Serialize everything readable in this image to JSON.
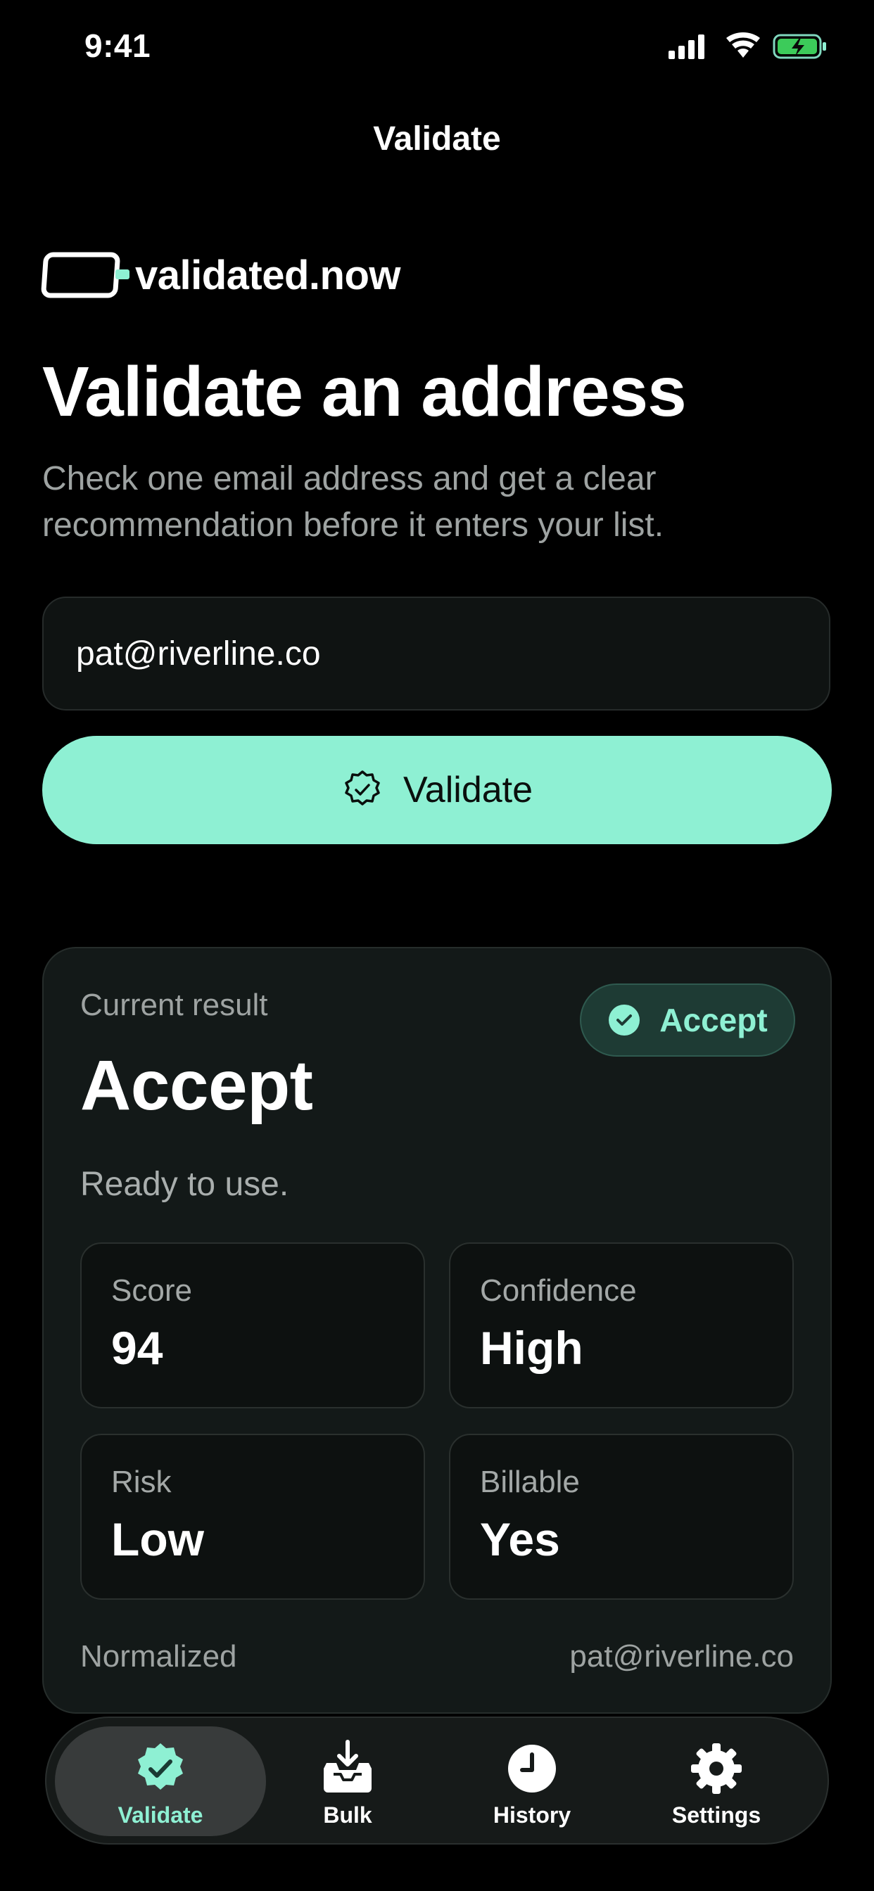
{
  "status_bar": {
    "time": "9:41"
  },
  "nav": {
    "title": "Validate"
  },
  "brand": {
    "name": "validated.now"
  },
  "header": {
    "title": "Validate an address",
    "subtitle": "Check one email address and get a clear recommendation before it enters your list."
  },
  "form": {
    "email_value": "pat@riverline.co",
    "validate_label": "Validate"
  },
  "result": {
    "kicker": "Current result",
    "title": "Accept",
    "badge_label": "Accept",
    "description": "Ready to use.",
    "metrics": [
      {
        "label": "Score",
        "value": "94"
      },
      {
        "label": "Confidence",
        "value": "High"
      },
      {
        "label": "Risk",
        "value": "Low"
      },
      {
        "label": "Billable",
        "value": "Yes"
      }
    ],
    "normalized_label": "Normalized",
    "normalized_value": "pat@riverline.co"
  },
  "tabs": [
    {
      "label": "Validate",
      "icon": "verified-badge-icon",
      "active": true
    },
    {
      "label": "Bulk",
      "icon": "inbox-download-icon",
      "active": false
    },
    {
      "label": "History",
      "icon": "clock-icon",
      "active": false
    },
    {
      "label": "Settings",
      "icon": "gear-icon",
      "active": false
    }
  ],
  "colors": {
    "accent": "#8ef0d3",
    "background": "#000000",
    "card": "#131918",
    "muted_text": "#9ea3a2"
  }
}
